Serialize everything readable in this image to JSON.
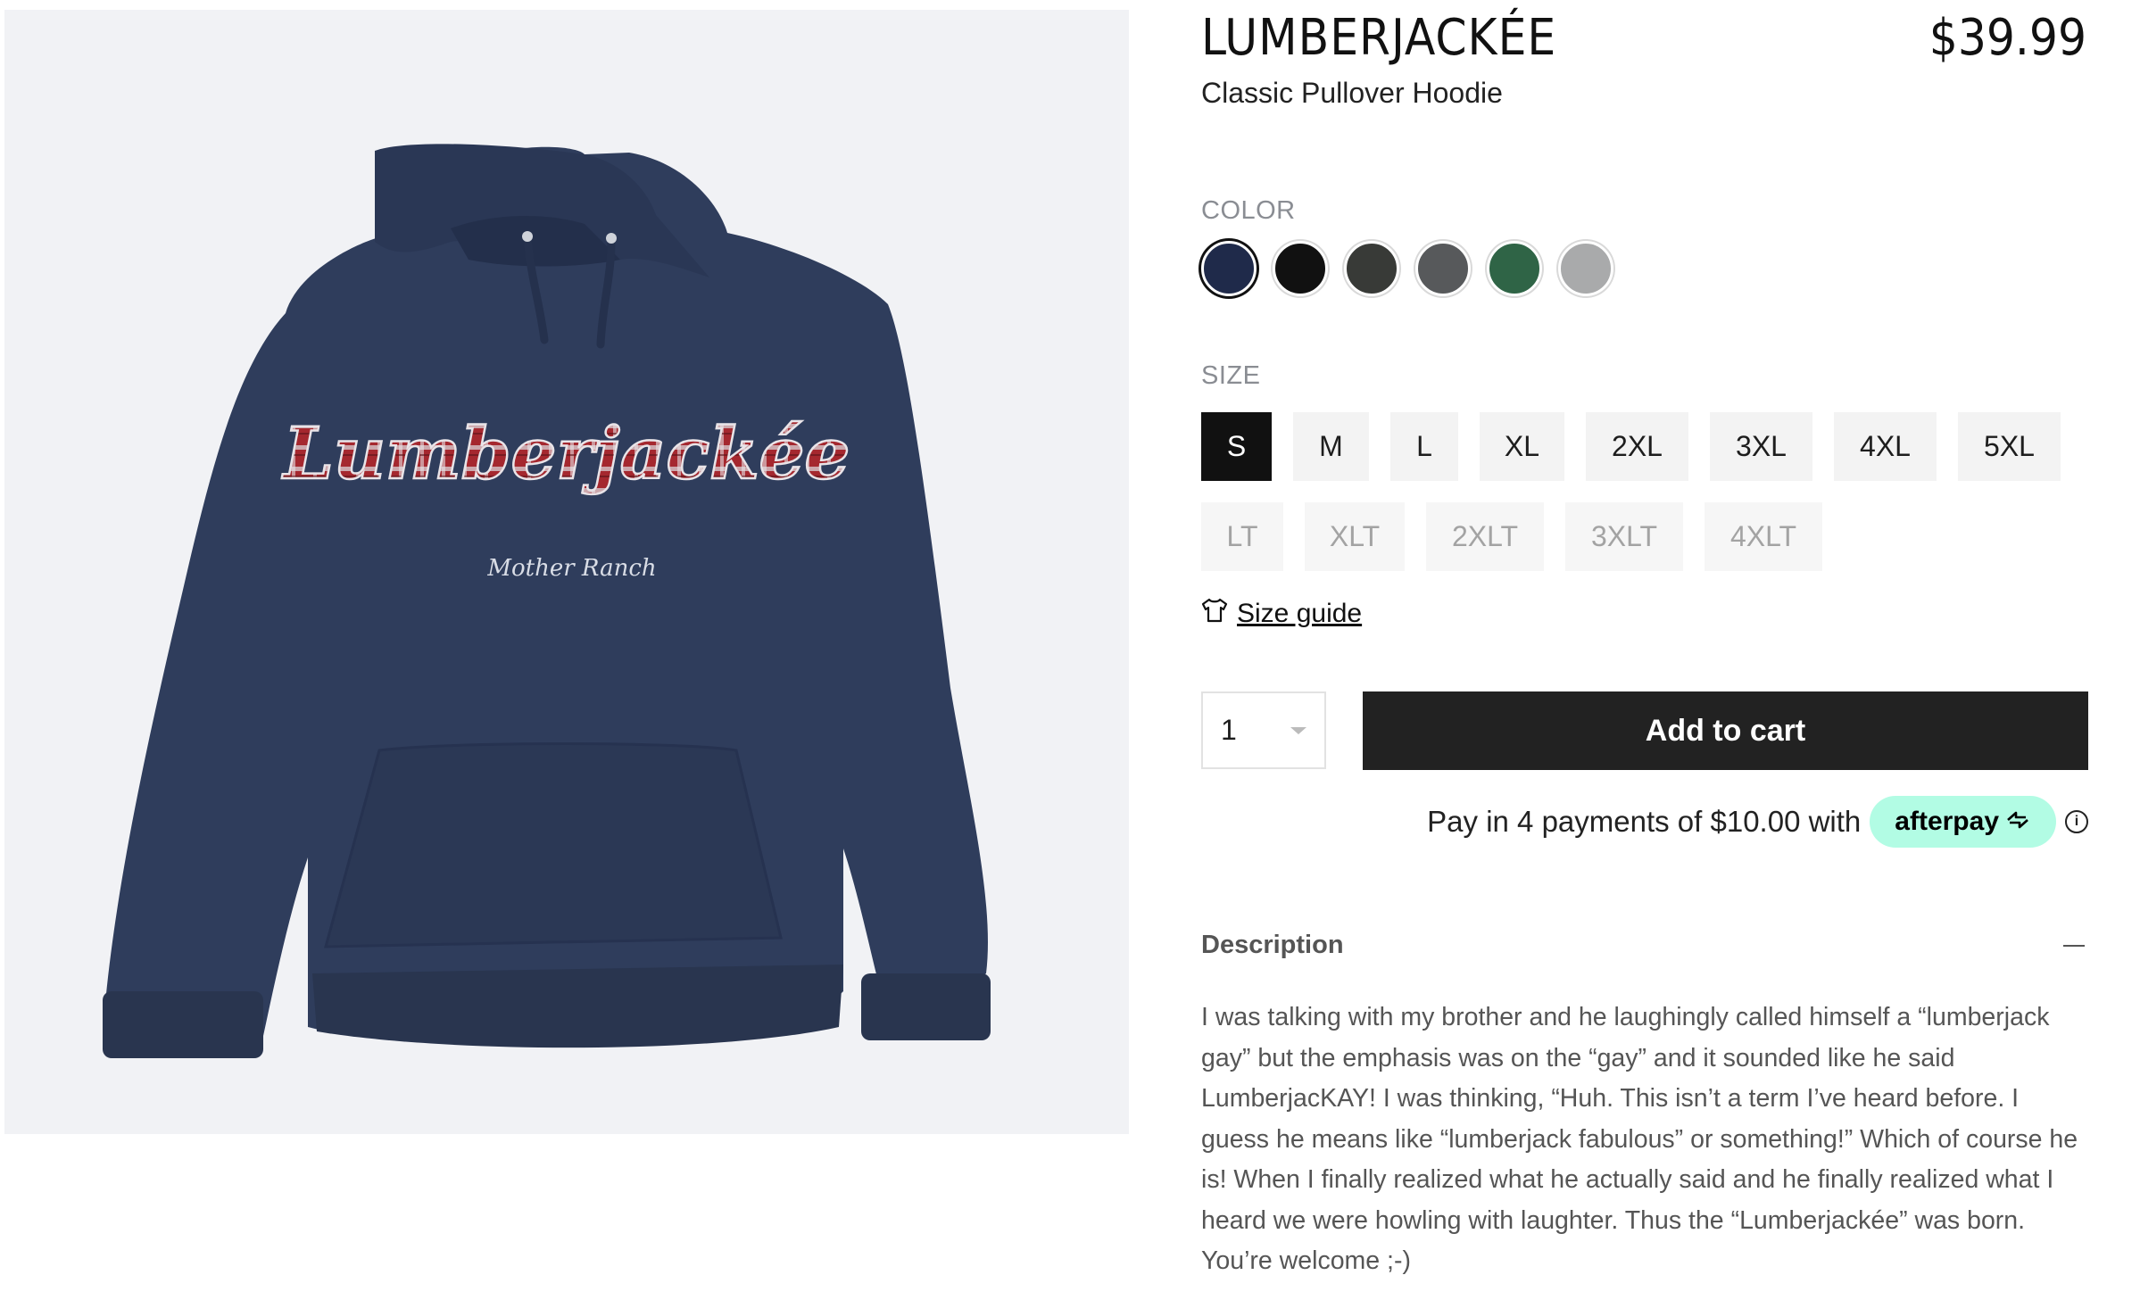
{
  "product": {
    "title": "LUMBERJACKÉE",
    "price": "$39.99",
    "subtitle": "Classic Pullover Hoodie",
    "image": {
      "print_text": "Lumberjackée",
      "signature_text": "Mother Ranch"
    }
  },
  "color": {
    "label": "COLOR",
    "options": [
      {
        "name": "navy",
        "hex": "#1f2a4a",
        "selected": true
      },
      {
        "name": "black",
        "hex": "#111111",
        "selected": false
      },
      {
        "name": "dark-heather",
        "hex": "#383a37",
        "selected": false
      },
      {
        "name": "charcoal",
        "hex": "#57595b",
        "selected": false
      },
      {
        "name": "forest-green",
        "hex": "#2f6446",
        "selected": false
      },
      {
        "name": "heather-grey",
        "hex": "#a9aaab",
        "selected": false
      }
    ]
  },
  "size": {
    "label": "SIZE",
    "row1": [
      {
        "label": "S",
        "selected": true
      },
      {
        "label": "M"
      },
      {
        "label": "L"
      },
      {
        "label": "XL"
      },
      {
        "label": "2XL"
      },
      {
        "label": "3XL"
      },
      {
        "label": "4XL"
      },
      {
        "label": "5XL"
      }
    ],
    "row2": [
      {
        "label": "LT"
      },
      {
        "label": "XLT"
      },
      {
        "label": "2XLT"
      },
      {
        "label": "3XLT"
      },
      {
        "label": "4XLT"
      }
    ],
    "guide_label": "Size guide"
  },
  "cart": {
    "quantity": "1",
    "add_label": "Add to cart"
  },
  "payment": {
    "text": "Pay in 4 payments of $10.00 with",
    "provider": "afterpay",
    "badge_color": "#b2fce4"
  },
  "description": {
    "title": "Description",
    "text": "I was talking with my brother and he laughingly called himself a “lumberjack gay” but the emphasis was on the “gay” and it sounded like he said LumberjacKAY! I was thinking, “Huh. This isn’t a term I’ve heard before. I guess he means like “lumberjack fabulous” or something!” Which of course he is! When I finally realized what he actually said and he finally realized what I heard we were howling with laughter. Thus the “Lumberjackée” was born. You’re welcome ;-)"
  }
}
